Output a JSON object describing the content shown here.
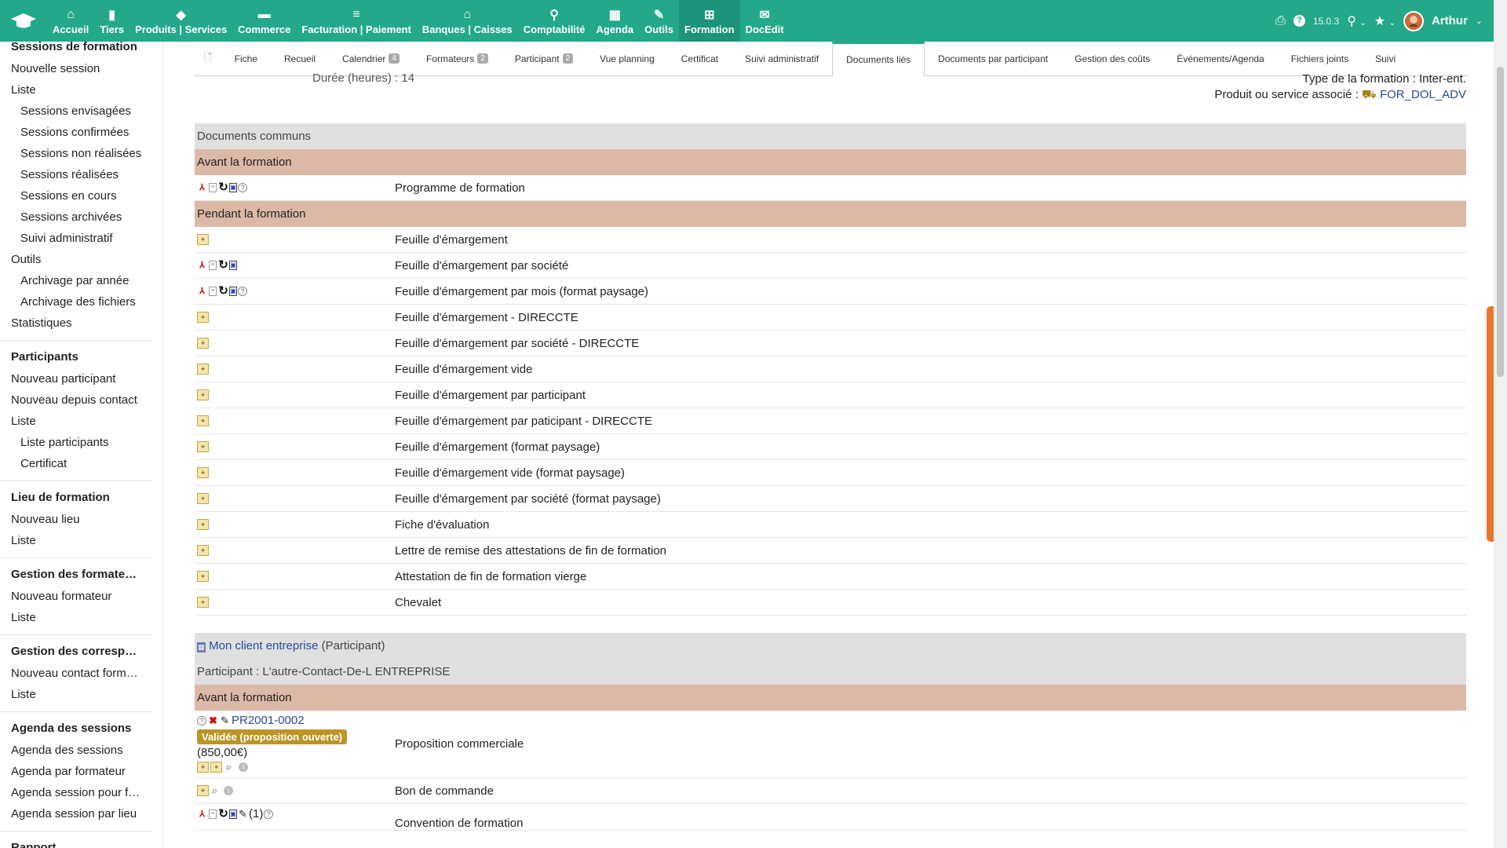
{
  "topbar": {
    "menu": [
      {
        "label": "Accueil",
        "icon": "home-icon",
        "glyph": "⌂"
      },
      {
        "label": "Tiers",
        "icon": "building-icon",
        "glyph": "▮"
      },
      {
        "label": "Produits | Services",
        "icon": "cube-icon",
        "glyph": "◆"
      },
      {
        "label": "Commerce",
        "icon": "briefcase-icon",
        "glyph": "▬"
      },
      {
        "label": "Facturation | Paiement",
        "icon": "coins-icon",
        "glyph": "≡"
      },
      {
        "label": "Banques | Caisses",
        "icon": "bank-icon",
        "glyph": "⌂"
      },
      {
        "label": "Comptabilité",
        "icon": "search-dollar-icon",
        "glyph": "⚲"
      },
      {
        "label": "Agenda",
        "icon": "calendar-icon",
        "glyph": "▦"
      },
      {
        "label": "Outils",
        "icon": "wrench-icon",
        "glyph": "✎"
      },
      {
        "label": "Formation",
        "icon": "sitemap-icon",
        "glyph": "⊞"
      },
      {
        "label": "DocEdit",
        "icon": "envelope-icon",
        "glyph": "✉"
      }
    ],
    "version": "15.0.3",
    "user": "Arthur"
  },
  "sidebar": [
    {
      "title": "Sessions de formation",
      "items": [
        {
          "label": "Nouvelle session",
          "sub": false
        },
        {
          "label": "Liste",
          "sub": false
        },
        {
          "label": "Sessions envisagées",
          "sub": true
        },
        {
          "label": "Sessions confirmées",
          "sub": true
        },
        {
          "label": "Sessions non réalisées",
          "sub": true
        },
        {
          "label": "Sessions réalisées",
          "sub": true
        },
        {
          "label": "Sessions en cours",
          "sub": true
        },
        {
          "label": "Sessions archivées",
          "sub": true
        },
        {
          "label": "Suivi administratif",
          "sub": true
        },
        {
          "label": "Outils",
          "sub": false
        },
        {
          "label": "Archivage par année",
          "sub": true
        },
        {
          "label": "Archivage des fichiers",
          "sub": true
        },
        {
          "label": "Statistiques",
          "sub": false
        }
      ]
    },
    {
      "title": "Participants",
      "items": [
        {
          "label": "Nouveau participant",
          "sub": false
        },
        {
          "label": "Nouveau depuis contact",
          "sub": false
        },
        {
          "label": "Liste",
          "sub": false
        },
        {
          "label": "Liste participants",
          "sub": true
        },
        {
          "label": "Certificat",
          "sub": true
        }
      ]
    },
    {
      "title": "Lieu de formation",
      "items": [
        {
          "label": "Nouveau lieu",
          "sub": false
        },
        {
          "label": "Liste",
          "sub": false
        }
      ]
    },
    {
      "title": "Gestion des formateurs",
      "items": [
        {
          "label": "Nouveau formateur",
          "sub": false
        },
        {
          "label": "Liste",
          "sub": false
        }
      ]
    },
    {
      "title": "Gestion des correspon…",
      "items": [
        {
          "label": "Nouveau contact formation",
          "sub": false
        },
        {
          "label": "Liste",
          "sub": false
        }
      ]
    },
    {
      "title": "Agenda des sessions",
      "items": [
        {
          "label": "Agenda des sessions",
          "sub": false
        },
        {
          "label": "Agenda par formateur",
          "sub": false
        },
        {
          "label": "Agenda session pour for…",
          "sub": false
        },
        {
          "label": "Agenda session par lieu",
          "sub": false
        }
      ]
    },
    {
      "title": "Rapport",
      "items": []
    }
  ],
  "tabs": [
    {
      "label": "",
      "badge": "",
      "icon": "document-icon"
    },
    {
      "label": "Fiche",
      "badge": ""
    },
    {
      "label": "Recueil",
      "badge": ""
    },
    {
      "label": "Calendrier",
      "badge": "4"
    },
    {
      "label": "Formateurs",
      "badge": "2"
    },
    {
      "label": "Participant",
      "badge": "2"
    },
    {
      "label": "Vue planning",
      "badge": ""
    },
    {
      "label": "Certificat",
      "badge": ""
    },
    {
      "label": "Suivi administratif",
      "badge": ""
    },
    {
      "label": "Documents liés",
      "badge": "",
      "active": true
    },
    {
      "label": "Documents par participant",
      "badge": ""
    },
    {
      "label": "Gestion des coûts",
      "badge": ""
    },
    {
      "label": "Événements/Agenda",
      "badge": ""
    },
    {
      "label": "Fichiers joints",
      "badge": ""
    },
    {
      "label": "Suivi",
      "badge": ""
    }
  ],
  "info": {
    "duration": "Durée (heures) : 14",
    "type": "Type de la formation : Inter-ent.",
    "product_label": "Produit ou service associé : ",
    "product_value": "FOR_DOL_ADV"
  },
  "common": {
    "header": "Documents communs",
    "before_label": "Avant la formation",
    "before_docs": [
      {
        "label": "Programme de formation",
        "icons": [
          "pdf",
          "file",
          "refresh",
          "odt",
          "help"
        ]
      }
    ],
    "during_label": "Pendant la formation",
    "during_docs": [
      {
        "label": "Feuille d'émargement",
        "icons": [
          "gen"
        ]
      },
      {
        "label": "Feuille d'émargement par société",
        "icons": [
          "pdf",
          "file",
          "refresh",
          "odt"
        ]
      },
      {
        "label": "Feuille d'émargement par mois (format paysage)",
        "icons": [
          "pdf",
          "file",
          "refresh",
          "odt",
          "help"
        ]
      },
      {
        "label": "Feuille d'émargement - DIRECCTE",
        "icons": [
          "gen"
        ]
      },
      {
        "label": "Feuille d'émargement par société - DIRECCTE",
        "icons": [
          "gen"
        ]
      },
      {
        "label": "Feuille d'émargement vide",
        "icons": [
          "gen"
        ]
      },
      {
        "label": "Feuille d'émargement par participant",
        "icons": [
          "gen"
        ]
      },
      {
        "label": "Feuille d'émargement par paticipant - DIRECCTE",
        "icons": [
          "gen"
        ]
      },
      {
        "label": "Feuille d'émargement (format paysage)",
        "icons": [
          "gen"
        ]
      },
      {
        "label": "Feuille d'émargement vide (format paysage)",
        "icons": [
          "gen"
        ]
      },
      {
        "label": "Feuille d'émargement par société (format paysage)",
        "icons": [
          "gen"
        ]
      },
      {
        "label": "Fiche d'évaluation",
        "icons": [
          "gen"
        ]
      },
      {
        "label": "Lettre de remise des attestations de fin de formation",
        "icons": [
          "gen"
        ]
      },
      {
        "label": "Attestation de fin de formation vierge",
        "icons": [
          "gen"
        ]
      },
      {
        "label": "Chevalet",
        "icons": [
          "gen"
        ]
      }
    ]
  },
  "client": {
    "name": "Mon client entreprise",
    "role": " (Participant)",
    "participant": "Participant : L'autre-Contact-De-L ENTREPRISE",
    "before_label": "Avant la formation",
    "proposal": {
      "ref": "PR2001-0002",
      "status": "Validée (proposition ouverte)",
      "amount": "(850,00€)",
      "label": "Proposition commerciale"
    },
    "order_label": "Bon de commande",
    "convention": {
      "label": "Convention de formation",
      "count": "(1)"
    }
  },
  "colors": {
    "topbar": "#23a88a",
    "category": "#dcb9a6",
    "header": "#e0e0e0",
    "status": "#bc9526",
    "link": "#2a4b96"
  }
}
